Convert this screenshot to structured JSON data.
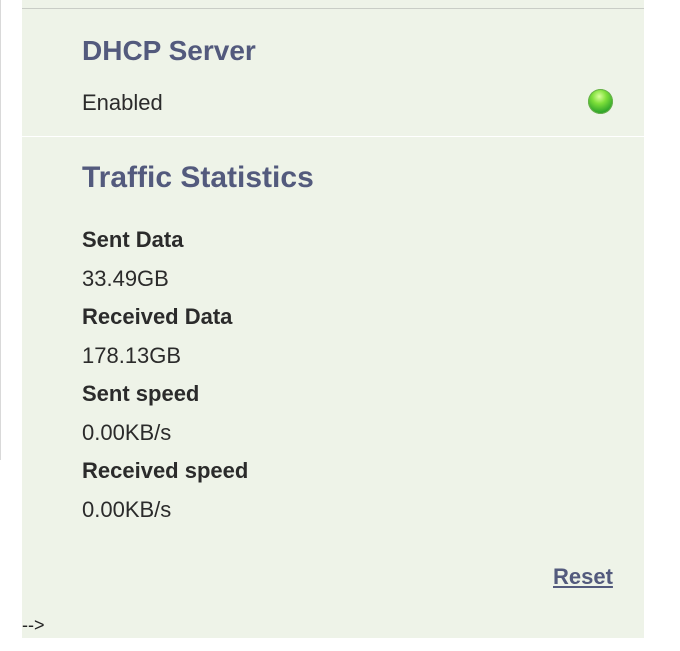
{
  "dhcp": {
    "title": "DHCP Server",
    "status": "Enabled",
    "status_color": "#3fbf2f",
    "status_icon": "green-status-led-icon"
  },
  "traffic": {
    "title": "Traffic Statistics",
    "items": [
      {
        "label": "Sent Data",
        "value": "33.49GB"
      },
      {
        "label": "Received Data",
        "value": "178.13GB"
      },
      {
        "label": "Sent speed",
        "value": "0.00KB/s"
      },
      {
        "label": "Received speed",
        "value": "0.00KB/s"
      }
    ],
    "reset_label": "Reset"
  },
  "footer": {
    "comment_remnant": "-->"
  },
  "colors": {
    "panel_background": "#eef3e8",
    "heading": "#535a7d",
    "text": "#2b2b2b"
  }
}
